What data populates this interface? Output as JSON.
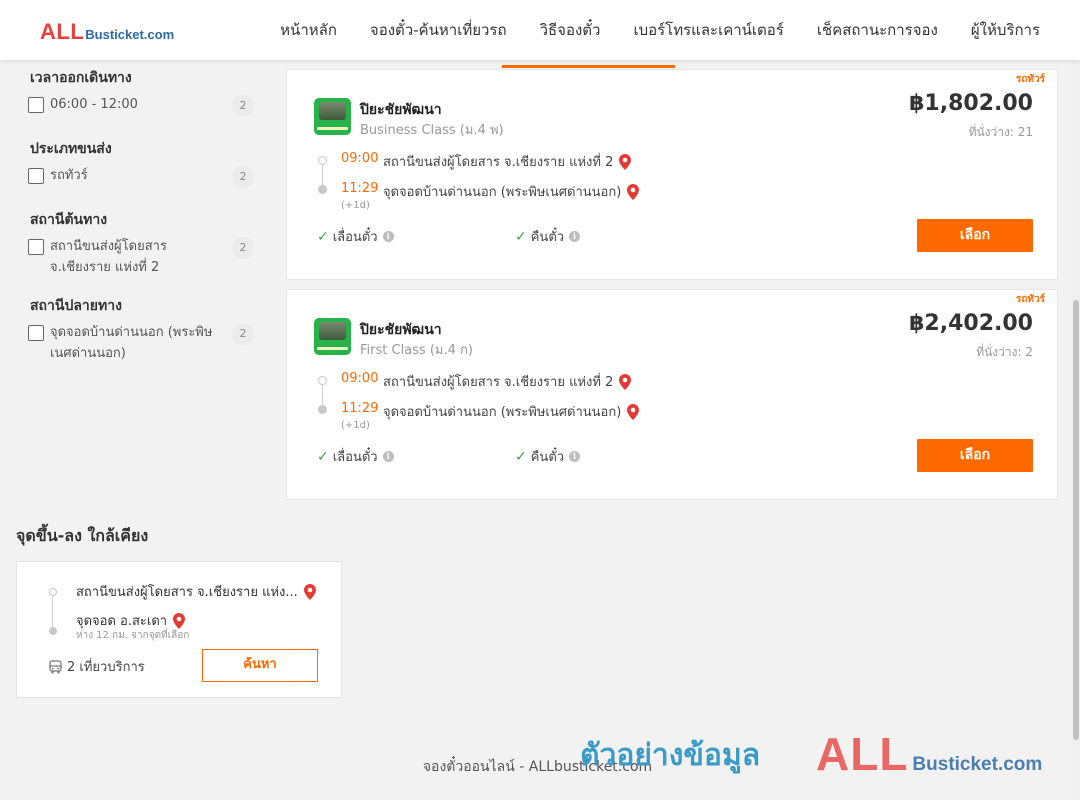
{
  "header": {
    "logo_all": "ALL",
    "logo_rest": "Busticket.com",
    "nav": [
      "หน้าหลัก",
      "จองตั๋ว-ค้นหาเที่ยวรถ",
      "วิธีจองตั๋ว",
      "เบอร์โทรและเคาน์เตอร์",
      "เช็คสถานะการจอง",
      "ผู้ให้บริการ"
    ]
  },
  "filters": {
    "departure_time": {
      "title": "เวลาออกเดินทาง",
      "option": "06:00 - 12:00",
      "count": "2"
    },
    "vehicle_type": {
      "title": "ประเภทขนส่ง",
      "option": "รถทัวร์",
      "count": "2"
    },
    "origin": {
      "title": "สถานีต้นทาง",
      "option": "สถานีขนส่งผู้โดยสาร จ.เชียงราย แห่งที่ 2",
      "count": "2"
    },
    "destination": {
      "title": "สถานีปลายทาง",
      "option": "จุดจอดบ้านด่านนอก (พระพิษเนศด่านนอก)",
      "count": "2"
    }
  },
  "results": [
    {
      "tag": "รถทัวร์",
      "operator": "ปิยะชัยพัฒนา",
      "class": "Business Class (ม.4 พ)",
      "price": "฿1,802.00",
      "seats": "ที่นั่งว่าง: 21",
      "depart_time": "09:00",
      "depart_station": "สถานีขนส่งผู้โดยสาร จ.เชียงราย แห่งที่ 2",
      "arrive_time": "11:29",
      "arrive_station": "จุดจอดบ้านด่านนอก (พระพิษเนศด่านนอก)",
      "plus_day": "(+1d)",
      "feature1": "เลื่อนตั๋ว",
      "feature2": "คืนตั๋ว",
      "select_label": "เลือก"
    },
    {
      "tag": "รถทัวร์",
      "operator": "ปิยะชัยพัฒนา",
      "class": "First Class (ม.4 ก)",
      "price": "฿2,402.00",
      "seats": "ที่นั่งว่าง: 2",
      "depart_time": "09:00",
      "depart_station": "สถานีขนส่งผู้โดยสาร จ.เชียงราย แห่งที่ 2",
      "arrive_time": "11:29",
      "arrive_station": "จุดจอดบ้านด่านนอก (พระพิษเนศด่านนอก)",
      "plus_day": "(+1d)",
      "feature1": "เลื่อนตั๋ว",
      "feature2": "คืนตั๋ว",
      "select_label": "เลือก"
    }
  ],
  "nearby": {
    "title": "จุดขึ้น-ลง ใกล้เคียง",
    "from": "สถานีขนส่งผู้โดยสาร จ.เชียงราย แห่ง...",
    "to": "จุดจอด อ.สะเดา",
    "distance": "ห่าง 12 กม. จากจุดที่เลือก",
    "trips": "2 เที่ยวบริการ",
    "search_label": "ค้นหา"
  },
  "footer": {
    "text": "จองตั๋วออนไลน์ - ALLbusticket.com",
    "watermark_text": "ตัวอย่างข้อมูล",
    "watermark_all": "ALL",
    "watermark_rest": "Busticket.com"
  },
  "colors": {
    "accent": "#ff6a00",
    "brand_red": "#e8413d",
    "brand_blue": "#2d6aa3",
    "check_green": "#3aa44a",
    "pin_red": "#e53935"
  }
}
